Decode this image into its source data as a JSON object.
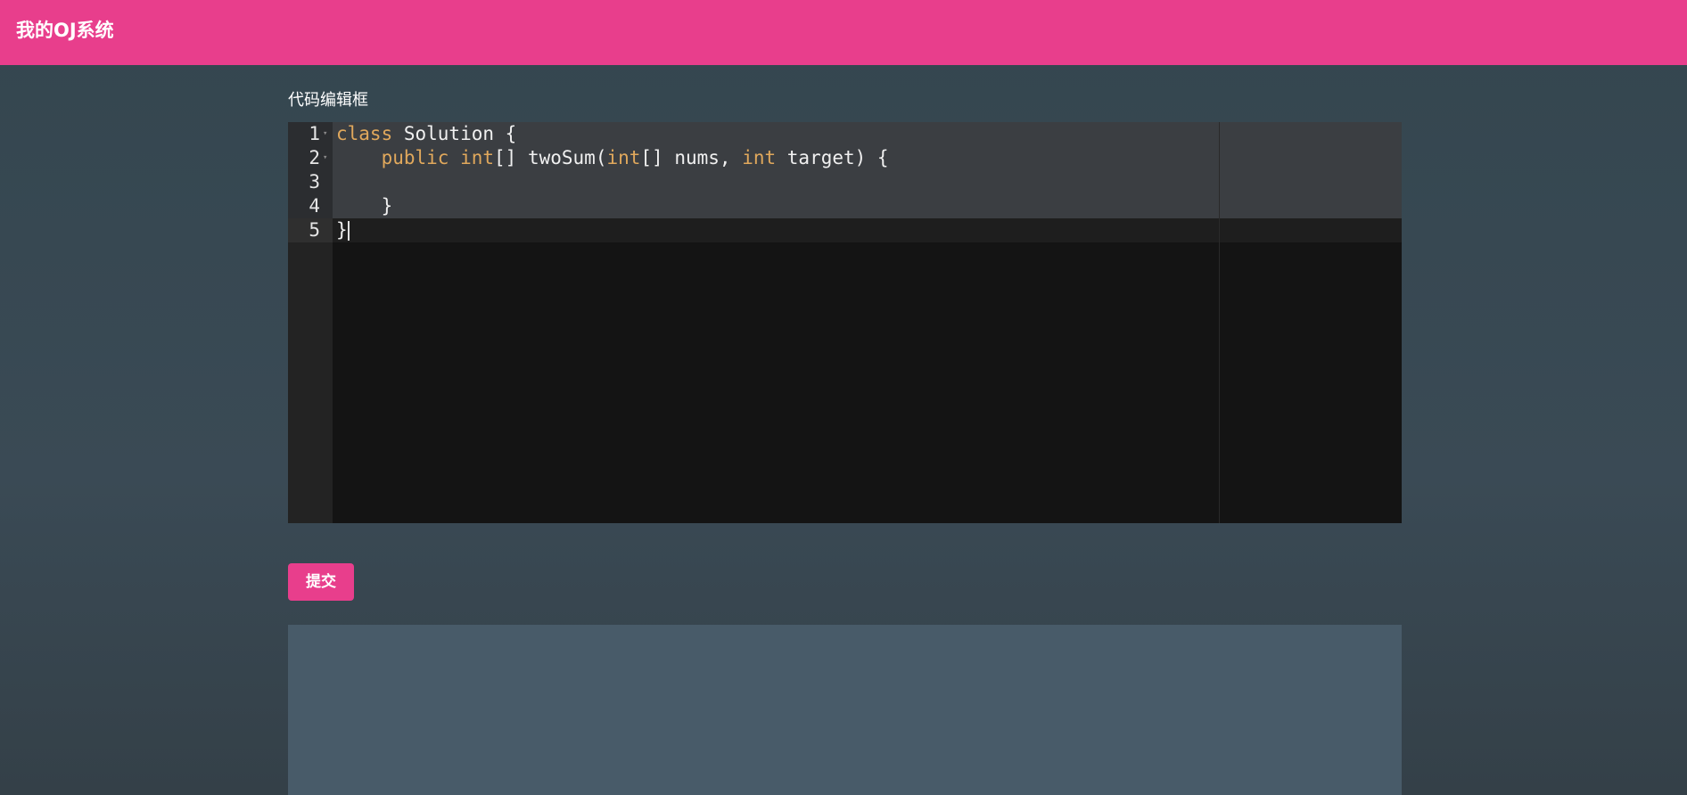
{
  "navbar": {
    "brand": "我的OJ系统",
    "background_color": "#e83e8c"
  },
  "editor": {
    "label": "代码编辑框",
    "lines": [
      {
        "number": "1",
        "foldable": true,
        "tokens": [
          {
            "t": "class",
            "kw": true
          },
          {
            "t": " Solution {",
            "kw": false
          }
        ]
      },
      {
        "number": "2",
        "foldable": true,
        "tokens": [
          {
            "t": "    ",
            "kw": false
          },
          {
            "t": "public",
            "kw": true
          },
          {
            "t": " ",
            "kw": false
          },
          {
            "t": "int",
            "kw": true
          },
          {
            "t": "[] twoSum(",
            "kw": false
          },
          {
            "t": "int",
            "kw": true
          },
          {
            "t": "[] nums, ",
            "kw": false
          },
          {
            "t": "int",
            "kw": true
          },
          {
            "t": " target) {",
            "kw": false
          }
        ]
      },
      {
        "number": "3",
        "foldable": false,
        "tokens": []
      },
      {
        "number": "4",
        "foldable": false,
        "tokens": [
          {
            "t": "    }",
            "kw": false
          }
        ]
      },
      {
        "number": "5",
        "foldable": false,
        "tokens": [
          {
            "t": "}",
            "kw": false
          }
        ],
        "cursor": true
      }
    ],
    "fold_icon": "triangle-down-icon",
    "keyword_color": "#e0a85c",
    "background_color": "#141414"
  },
  "submit": {
    "label": "提交",
    "color": "#e83e8c"
  },
  "result_panel": {
    "background_color": "#485b69"
  }
}
